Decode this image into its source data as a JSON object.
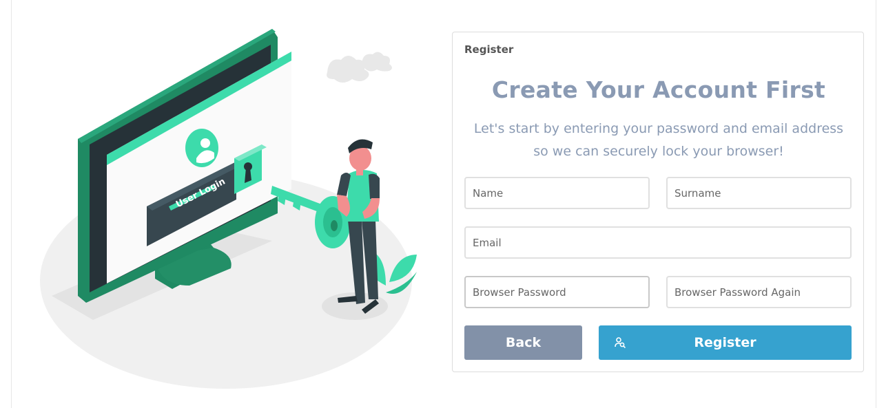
{
  "illustration": {
    "screen_text": "User Login",
    "icon": "key-user-login-illustration"
  },
  "form": {
    "header_label": "Register",
    "title": "Create Your Account First",
    "subtitle_line1": "Let's start by entering your password and email address",
    "subtitle_line2": "so we can securely lock your browser!",
    "fields": {
      "name": {
        "placeholder": "Name",
        "value": ""
      },
      "surname": {
        "placeholder": "Surname",
        "value": ""
      },
      "email": {
        "placeholder": "Email",
        "value": ""
      },
      "browser_password": {
        "placeholder": "Browser Password",
        "value": ""
      },
      "browser_password_again": {
        "placeholder": "Browser Password Again",
        "value": ""
      }
    },
    "buttons": {
      "back_label": "Back",
      "register_label": "Register",
      "register_icon": "user-search-icon"
    }
  },
  "colors": {
    "accent_green": "#3ddbab",
    "dark_green": "#1f8a63",
    "title_gray_blue": "#8a9ab3",
    "back_button": "#8291a8",
    "register_button": "#36a2cf"
  }
}
